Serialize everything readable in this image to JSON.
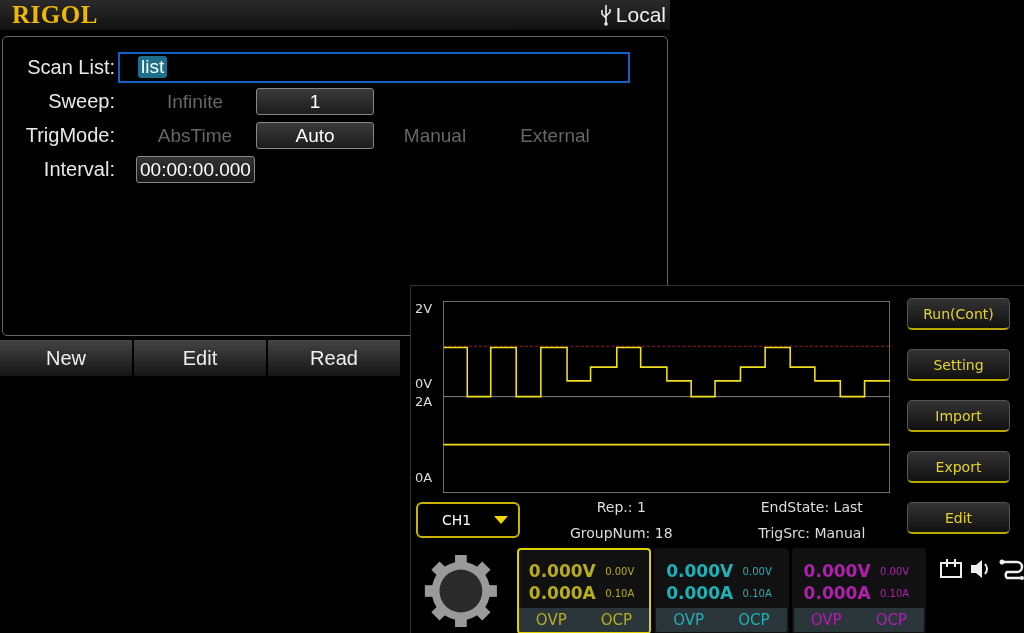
{
  "main_screen": {
    "logo": "RIGOL",
    "status": "Local",
    "form": {
      "scan_list": {
        "label": "Scan List:",
        "value": "list"
      },
      "sweep": {
        "label": "Sweep:",
        "options": [
          {
            "label": "Infinite",
            "selected": false
          },
          {
            "label": "1",
            "selected": true
          }
        ]
      },
      "trig_mode": {
        "label": "TrigMode:",
        "options": [
          {
            "label": "AbsTime",
            "selected": false
          },
          {
            "label": "Auto",
            "selected": true
          },
          {
            "label": "Manual",
            "selected": false
          },
          {
            "label": "External",
            "selected": false
          }
        ]
      },
      "interval": {
        "label": "Interval:",
        "value": "00:00:00.000"
      }
    },
    "softkeys": [
      "New",
      "Edit",
      "Read"
    ]
  },
  "list_window": {
    "axis_labels": {
      "voltage_top": "2V",
      "voltage_bottom": "0V",
      "current_top": "2A",
      "current_bottom": "0A"
    },
    "buttons": [
      "Run(Cont)",
      "Setting",
      "Import",
      "Export",
      "Edit"
    ],
    "channel_select": "CH1",
    "info": [
      {
        "label": "Rep.:",
        "value": "1"
      },
      {
        "label": "EndState:",
        "value": "Last"
      },
      {
        "label": "GroupNum:",
        "value": "18"
      },
      {
        "label": "TrigSrc:",
        "value": "Manual"
      }
    ],
    "channels": [
      {
        "voltage": "0.000V",
        "current": "0.000A",
        "voltage_set": "0.00V",
        "current_set": "0.10A",
        "ovp": "OVP",
        "ocp": "OCP",
        "color": "#b8ad1a",
        "selected": true
      },
      {
        "voltage": "0.000V",
        "current": "0.000A",
        "voltage_set": "0.00V",
        "current_set": "0.10A",
        "ovp": "OVP",
        "ocp": "OCP",
        "color": "#1fb0b8",
        "selected": false
      },
      {
        "voltage": "0.000V",
        "current": "0.000A",
        "voltage_set": "0.00V",
        "current_set": "0.10A",
        "ovp": "OVP",
        "ocp": "OCP",
        "color": "#b21fb0",
        "selected": false
      }
    ]
  }
}
